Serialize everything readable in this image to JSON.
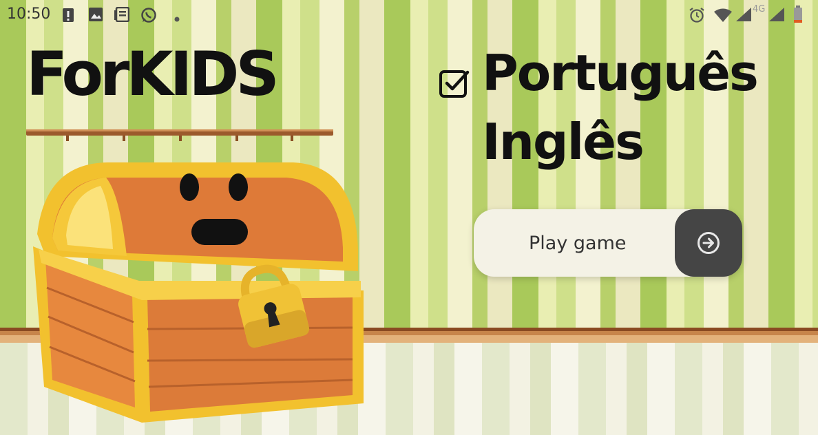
{
  "status_bar": {
    "time": "10:50",
    "network_label": "4G",
    "icons": [
      "alert-icon",
      "image-icon",
      "news-icon",
      "whatsapp-icon",
      "dot-icon",
      "alarm-icon",
      "wifi-icon",
      "signal-icon",
      "battery-icon"
    ]
  },
  "app": {
    "title": "ForKIDS",
    "languages": {
      "selected": "Português",
      "other": "Inglês"
    },
    "play_button_label": "Play game"
  },
  "colors": {
    "wall_green": "#a9c95a",
    "chest_orange": "#dc7b39",
    "chest_gold": "#f4c531",
    "play_button_bg": "#454545"
  }
}
